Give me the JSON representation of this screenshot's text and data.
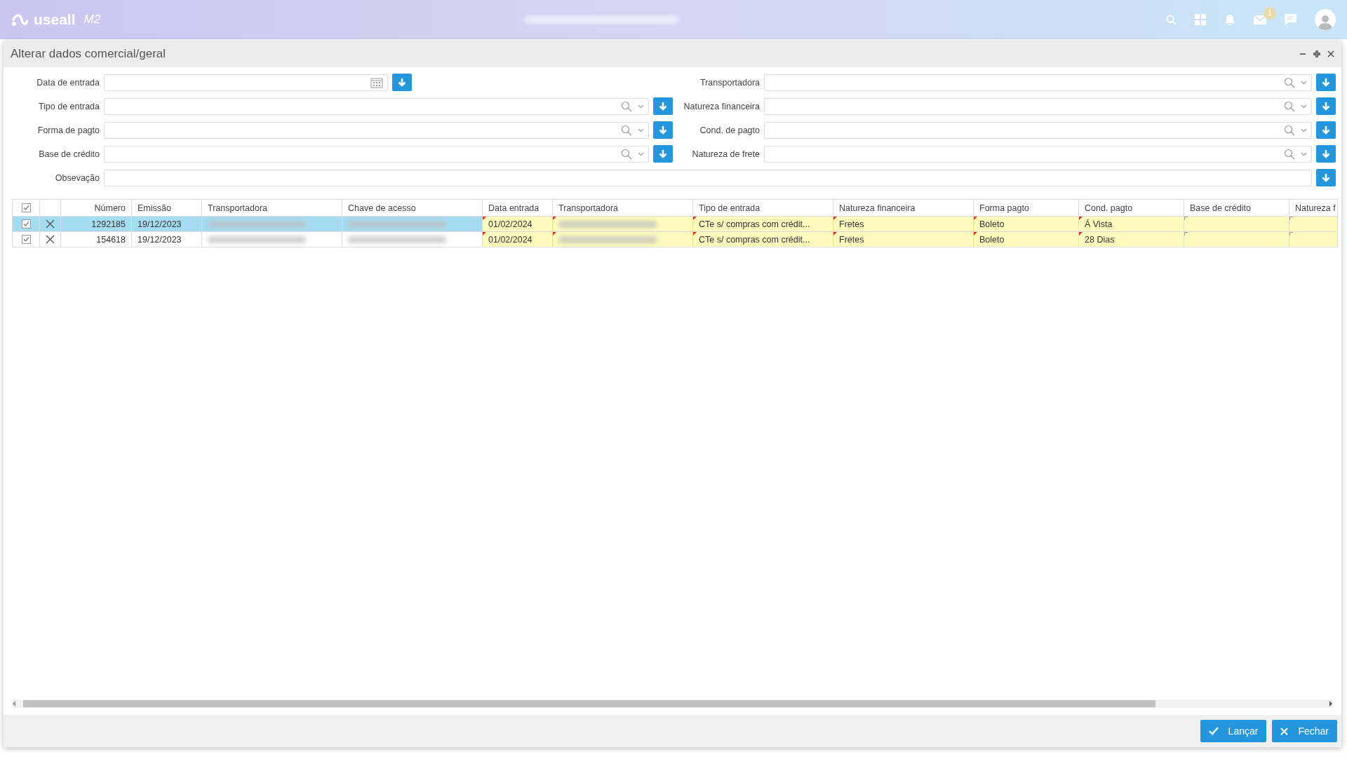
{
  "app": {
    "logo": "useall",
    "version": "M2",
    "notifications": "1"
  },
  "dialog": {
    "title": "Alterar dados comercial/geral"
  },
  "form": {
    "left": [
      {
        "label": "Data de entrada",
        "kind": "date"
      },
      {
        "label": "Tipo de entrada",
        "kind": "lookup"
      },
      {
        "label": "Forma de pagto",
        "kind": "lookup"
      },
      {
        "label": "Base de crédito",
        "kind": "lookup"
      }
    ],
    "right": [
      {
        "label": "Transportadora",
        "kind": "lookup"
      },
      {
        "label": "Natureza financeira",
        "kind": "lookup"
      },
      {
        "label": "Cond. de pagto",
        "kind": "lookup"
      },
      {
        "label": "Natureza de frete",
        "kind": "lookup"
      }
    ],
    "note": {
      "label": "Obsevação"
    }
  },
  "table": {
    "all_checked": true,
    "columns": [
      {
        "label": "Número",
        "editable": false
      },
      {
        "label": "Emissão",
        "editable": false
      },
      {
        "label": "Transportadora",
        "editable": false
      },
      {
        "label": "Chave de acesso",
        "editable": false
      },
      {
        "label": "Data entrada",
        "editable": true
      },
      {
        "label": "Transportadora",
        "editable": true
      },
      {
        "label": "Tipo de entrada",
        "editable": true
      },
      {
        "label": "Natureza financeira",
        "editable": true
      },
      {
        "label": "Forma pagto",
        "editable": true
      },
      {
        "label": "Cond. pagto",
        "editable": true
      },
      {
        "label": "Base de crédito",
        "editable": true
      },
      {
        "label": "Natureza f",
        "editable": true
      }
    ],
    "rows": [
      {
        "selected": true,
        "checked": true,
        "cells": [
          {
            "kind": "text",
            "text": "1292185"
          },
          {
            "kind": "text",
            "text": "19/12/2023"
          },
          {
            "kind": "blurred"
          },
          {
            "kind": "blurred"
          },
          {
            "kind": "text",
            "text": "01/02/2024",
            "modified": true
          },
          {
            "kind": "blurred",
            "modified": true
          },
          {
            "kind": "text",
            "text": "CTe s/ compras com crédit...",
            "modified": true
          },
          {
            "kind": "text",
            "text": "Fretes",
            "modified": true
          },
          {
            "kind": "text",
            "text": "Boleto",
            "modified": true
          },
          {
            "kind": "text",
            "text": "Á Vista",
            "modified": true
          },
          {
            "kind": "empty",
            "modified": false
          },
          {
            "kind": "empty",
            "modified": false
          }
        ]
      },
      {
        "selected": false,
        "checked": true,
        "cells": [
          {
            "kind": "text",
            "text": "154618"
          },
          {
            "kind": "text",
            "text": "19/12/2023"
          },
          {
            "kind": "blurred"
          },
          {
            "kind": "blurred"
          },
          {
            "kind": "text",
            "text": "01/02/2024",
            "modified": true
          },
          {
            "kind": "blurred",
            "modified": true
          },
          {
            "kind": "text",
            "text": "CTe s/ compras com crédit...",
            "modified": true
          },
          {
            "kind": "text",
            "text": "Fretes",
            "modified": true
          },
          {
            "kind": "text",
            "text": "Boleto",
            "modified": true
          },
          {
            "kind": "text",
            "text": "28 Dias",
            "modified": true
          },
          {
            "kind": "empty",
            "modified": false
          },
          {
            "kind": "empty",
            "modified": false
          }
        ]
      }
    ]
  },
  "buttons": [
    {
      "label": "Lançar",
      "kind": "confirm"
    },
    {
      "label": "Fechar",
      "kind": "close"
    }
  ]
}
